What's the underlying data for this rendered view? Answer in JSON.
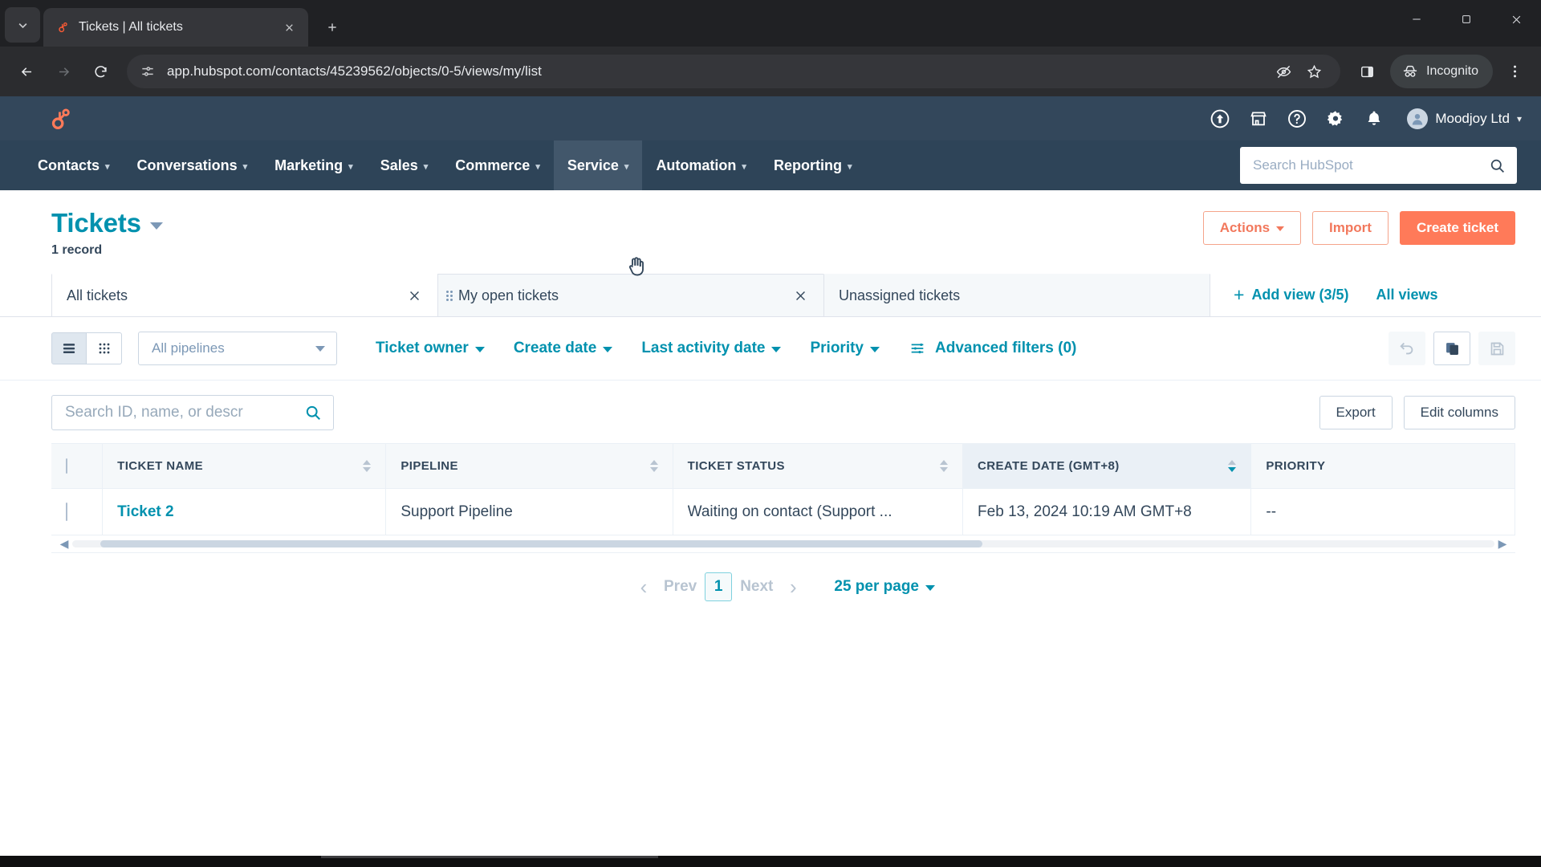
{
  "browser": {
    "tab": {
      "title": "Tickets | All tickets",
      "favicon": "hubspot-sprocket-icon"
    },
    "tab_search_icon": "chevron-down-icon",
    "new_tab_icon": "plus-icon",
    "window_controls": {
      "minimize": "minimize-icon",
      "maximize": "maximize-icon",
      "close": "close-icon"
    },
    "nav": {
      "back": "back-arrow-icon",
      "forward": "forward-arrow-icon",
      "reload": "reload-icon"
    },
    "omnibox": {
      "site_info_icon": "site-settings-icon",
      "url": "app.hubspot.com/contacts/45239562/objects/0-5/views/my/list",
      "tracking_icon": "eye-slash-icon",
      "bookmark_icon": "star-icon"
    },
    "side_panel_icon": "side-panel-icon",
    "incognito": {
      "label": "Incognito",
      "icon": "incognito-hat-icon"
    },
    "menu_icon": "three-dot-menu-icon"
  },
  "hubspot": {
    "logo": "hubspot-sprocket-logo",
    "topbar_icons": [
      {
        "name": "upgrade-icon"
      },
      {
        "name": "marketplace-icon"
      },
      {
        "name": "help-icon"
      },
      {
        "name": "settings-gear-icon"
      },
      {
        "name": "notifications-bell-icon"
      }
    ],
    "account": {
      "name": "Moodjoy Ltd",
      "caret": "chevron-down-icon",
      "avatar": "user-avatar"
    },
    "nav_items": [
      {
        "label": "Contacts",
        "active": false
      },
      {
        "label": "Conversations",
        "active": false
      },
      {
        "label": "Marketing",
        "active": false
      },
      {
        "label": "Sales",
        "active": false
      },
      {
        "label": "Commerce",
        "active": false
      },
      {
        "label": "Service",
        "active": true
      },
      {
        "label": "Automation",
        "active": false
      },
      {
        "label": "Reporting",
        "active": false
      }
    ],
    "global_search": {
      "placeholder": "Search HubSpot",
      "icon": "search-icon"
    }
  },
  "page": {
    "title": "Tickets",
    "title_caret": "chevron-down-icon",
    "record_count": "1 record",
    "actions": {
      "actions_label": "Actions",
      "import_label": "Import",
      "create_label": "Create ticket"
    }
  },
  "views": {
    "tabs": [
      {
        "label": "All tickets",
        "active": true,
        "dragging": false,
        "close_icon": "close-icon"
      },
      {
        "label": "My open tickets",
        "active": false,
        "dragging": true,
        "close_icon": "close-icon",
        "handle_icon": "drag-handle-icon"
      },
      {
        "label": "Unassigned tickets",
        "active": false,
        "dragging": false,
        "close_icon": ""
      }
    ],
    "add_view_label": "Add view (3/5)",
    "add_view_icon": "plus-icon",
    "all_views_label": "All views",
    "cursor_icon": "grab-hand-cursor"
  },
  "filters": {
    "list_view_icon": "list-view-icon",
    "board_view_icon": "board-view-icon",
    "pipeline": {
      "value": "All pipelines",
      "caret": "chevron-down-icon"
    },
    "items": [
      {
        "label": "Ticket owner"
      },
      {
        "label": "Create date"
      },
      {
        "label": "Last activity date"
      },
      {
        "label": "Priority"
      }
    ],
    "advanced": {
      "label": "Advanced filters (0)",
      "icon": "filter-sliders-icon"
    },
    "right_icons": [
      {
        "name": "undo-icon",
        "active": false
      },
      {
        "name": "copy-view-icon",
        "active": true
      },
      {
        "name": "save-view-icon",
        "active": false
      }
    ]
  },
  "table_toolbar": {
    "search_placeholder": "Search ID, name, or descr",
    "search_value": "",
    "search_icon": "search-icon",
    "export_label": "Export",
    "edit_columns_label": "Edit columns"
  },
  "table": {
    "select_all_icon": "checkbox-unchecked",
    "columns": [
      {
        "label": "TICKET NAME",
        "sortable": true,
        "sorted": false
      },
      {
        "label": "PIPELINE",
        "sortable": true,
        "sorted": false
      },
      {
        "label": "TICKET STATUS",
        "sortable": true,
        "sorted": false
      },
      {
        "label": "CREATE DATE (GMT+8)",
        "sortable": true,
        "sorted": true,
        "direction": "desc"
      },
      {
        "label": "PRIORITY",
        "sortable": false,
        "sorted": false
      }
    ],
    "rows": [
      {
        "checkbox": "checkbox-unchecked",
        "ticket_name": "Ticket 2",
        "pipeline": "Support Pipeline",
        "ticket_status": "Waiting on contact (Support ...",
        "create_date": "Feb 13, 2024 10:19 AM GMT+8",
        "priority": "--"
      }
    ],
    "scroll_left_icon": "chevron-left-icon",
    "scroll_right_icon": "chevron-right-icon"
  },
  "pagination": {
    "prev_arrow": "chevron-left-icon",
    "prev_label": "Prev",
    "current_page": "1",
    "next_label": "Next",
    "next_arrow": "chevron-right-icon",
    "per_page_label": "25 per page",
    "per_page_caret": "chevron-down-icon"
  },
  "colors": {
    "hubspot_orange": "#ff7a59",
    "hubspot_navy": "#33475b",
    "nav_navy": "#2e4458",
    "teal_link": "#0091ae",
    "border_light": "#dfe3eb",
    "table_header_bg": "#f5f8fa",
    "sorted_header_bg": "#eaf0f6"
  }
}
